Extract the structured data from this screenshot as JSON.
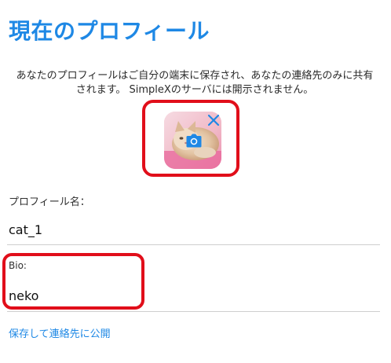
{
  "header": {
    "title": "現在のプロフィール"
  },
  "description": {
    "line1": "あなたのプロフィールはご自分の端末に保存され、あなたの連絡先のみに共有",
    "line2": "されます。 SimpleXのサーバには開示されません。"
  },
  "avatar": {
    "image_subject": "cat-photo",
    "camera_icon": "camera-icon",
    "clear_icon": "close-icon",
    "accent": "#1e88e5"
  },
  "form": {
    "profile_name": {
      "label": "プロフィール名：",
      "value": "cat_1"
    },
    "bio": {
      "label": "Bio:",
      "value": "neko"
    }
  },
  "actions": {
    "save_label": "保存して連絡先に公開"
  },
  "colors": {
    "accent": "#1e88e5",
    "highlight": "#e10e1a",
    "divider": "#cfcfcf"
  }
}
